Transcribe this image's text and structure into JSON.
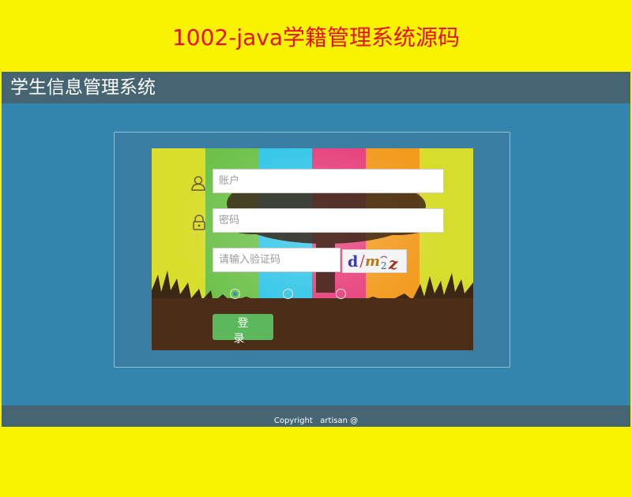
{
  "banner": {
    "text": "1002-java学籍管理系统源码"
  },
  "header": {
    "title": "学生信息管理系统"
  },
  "login": {
    "username_placeholder": "账户",
    "password_placeholder": "密码",
    "captcha_placeholder": "请输入验证码",
    "captcha_text": "dm2z",
    "login_label": "登 录",
    "roles": [
      {
        "checked": true
      },
      {
        "checked": false
      },
      {
        "checked": false
      }
    ],
    "stripe_colors": [
      "#d9dd2c",
      "#6dc14a",
      "#2fc5e8",
      "#e63d7a",
      "#f29a1c",
      "#d6dd2c"
    ]
  },
  "footer": {
    "copyright": "Copyright   artisan @"
  },
  "colors": {
    "banner_text": "#e8101e",
    "page_bg": "#f9f200",
    "app_bg": "#3385ad",
    "header_bg": "#466573",
    "button_bg": "#5cb85c"
  },
  "icons": {
    "user": "user-icon",
    "lock": "lock-icon"
  }
}
